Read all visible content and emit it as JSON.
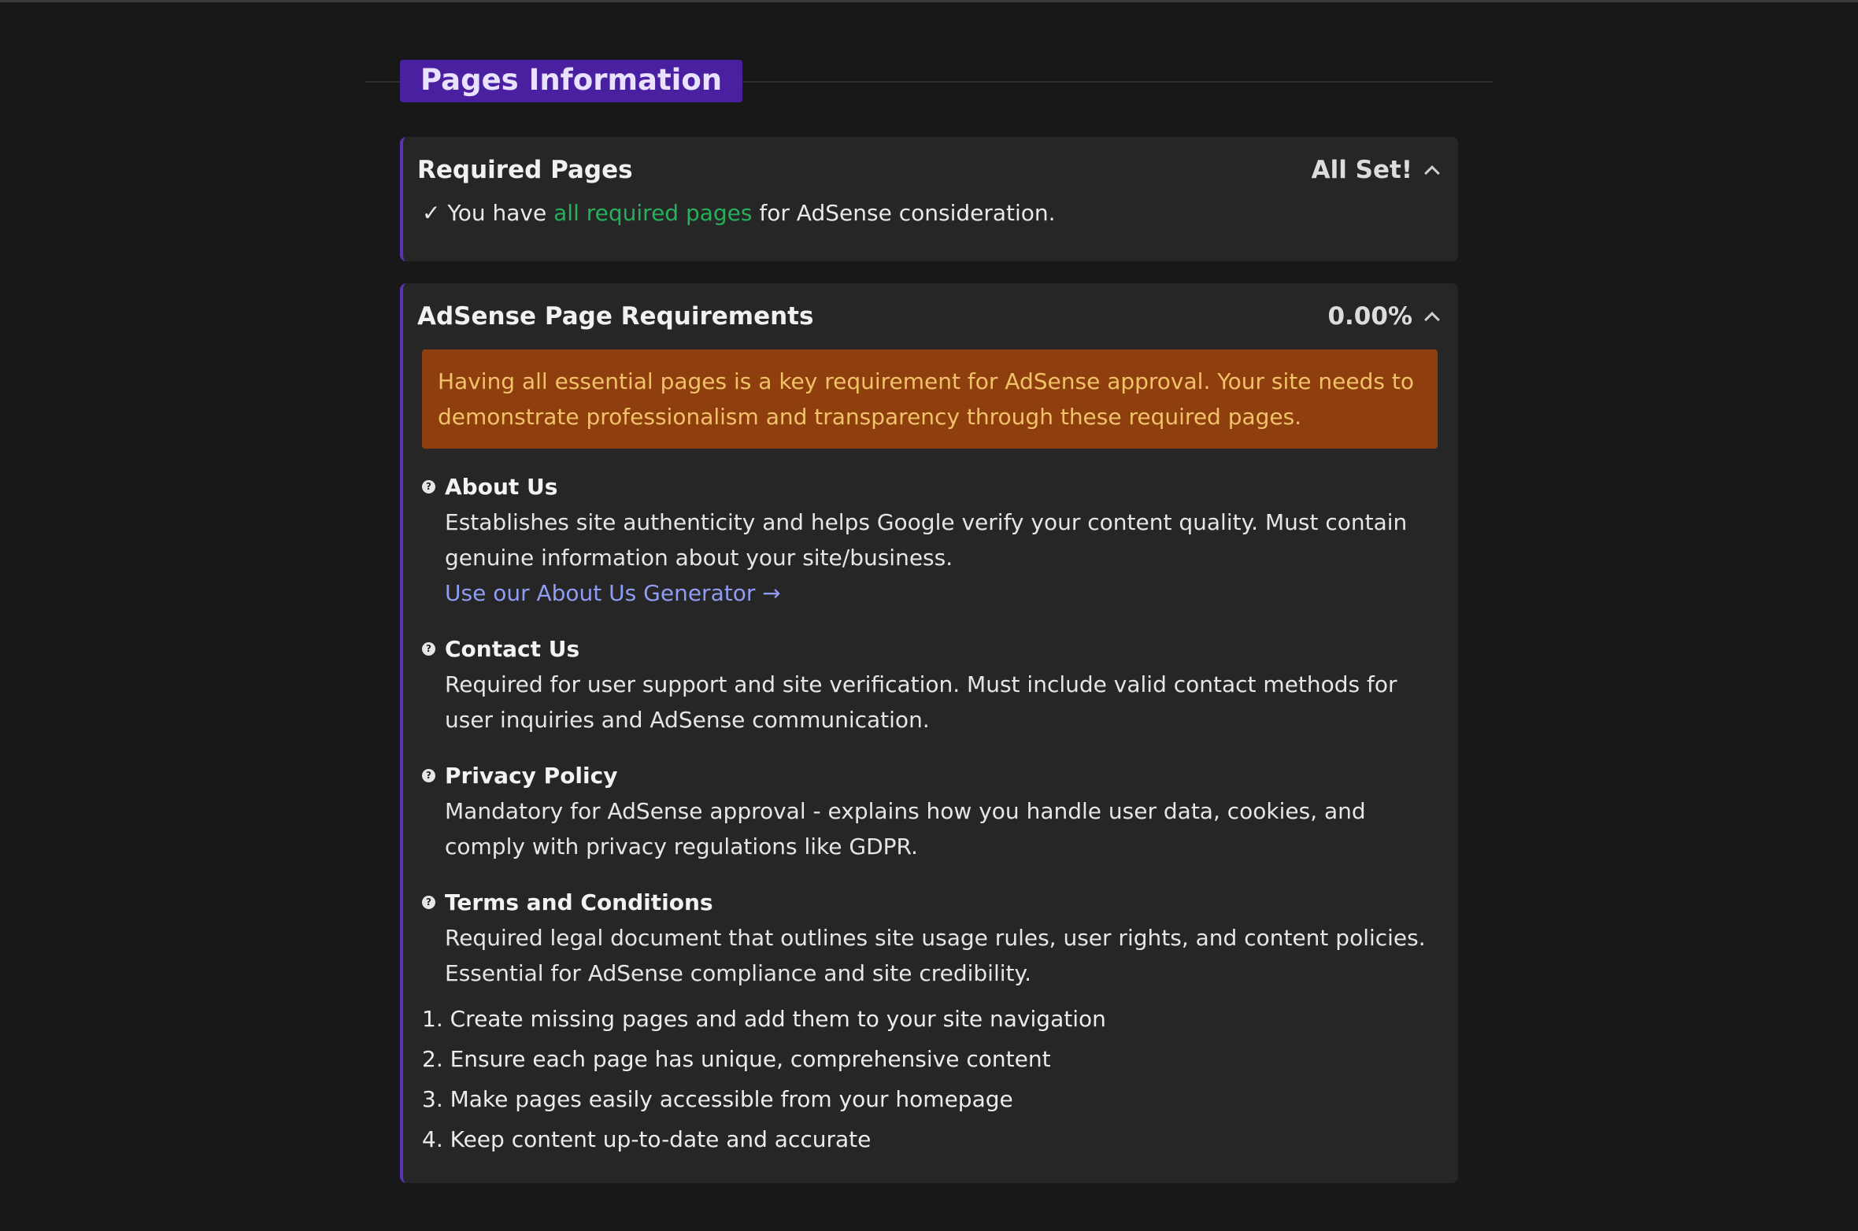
{
  "section": {
    "title": "Pages Information"
  },
  "required_pages": {
    "title": "Required Pages",
    "status": "All Set!",
    "message_prefix": "✓ You have",
    "message_highlight": "all required pages",
    "message_suffix": "for AdSense consideration."
  },
  "adsense": {
    "title": "AdSense Page Requirements",
    "score": "0.00%",
    "warning": "Having all essential pages is a key requirement for AdSense approval. Your site needs to demonstrate professionalism and transparency through these required pages.",
    "requirements": [
      {
        "name": "About Us",
        "description": "Establishes site authenticity and helps Google verify your content quality. Must contain genuine information about your site/business.",
        "link": "Use our About Us Generator →"
      },
      {
        "name": "Contact Us",
        "description": "Required for user support and site verification. Must include valid contact methods for user inquiries and AdSense communication."
      },
      {
        "name": "Privacy Policy",
        "description": "Mandatory for AdSense approval - explains how you handle user data, cookies, and comply with privacy regulations like GDPR."
      },
      {
        "name": "Terms and Conditions",
        "description": "Required legal document that outlines site usage rules, user rights, and content policies. Essential for AdSense compliance and site credibility."
      }
    ],
    "steps": [
      "1. Create missing pages and add them to your site navigation",
      "2. Ensure each page has unique, comprehensive content",
      "3. Make pages easily accessible from your homepage",
      "4. Keep content up-to-date and accurate"
    ]
  },
  "icons": {
    "requirement_icon": "question-circle-icon",
    "collapse_icon": "chevron-up-icon"
  },
  "colors": {
    "accent": "#4a1fa0",
    "success": "#25b05a",
    "warning_bg": "#8f3f0e",
    "warning_text": "#f1c268",
    "link": "#8f9cf3"
  }
}
